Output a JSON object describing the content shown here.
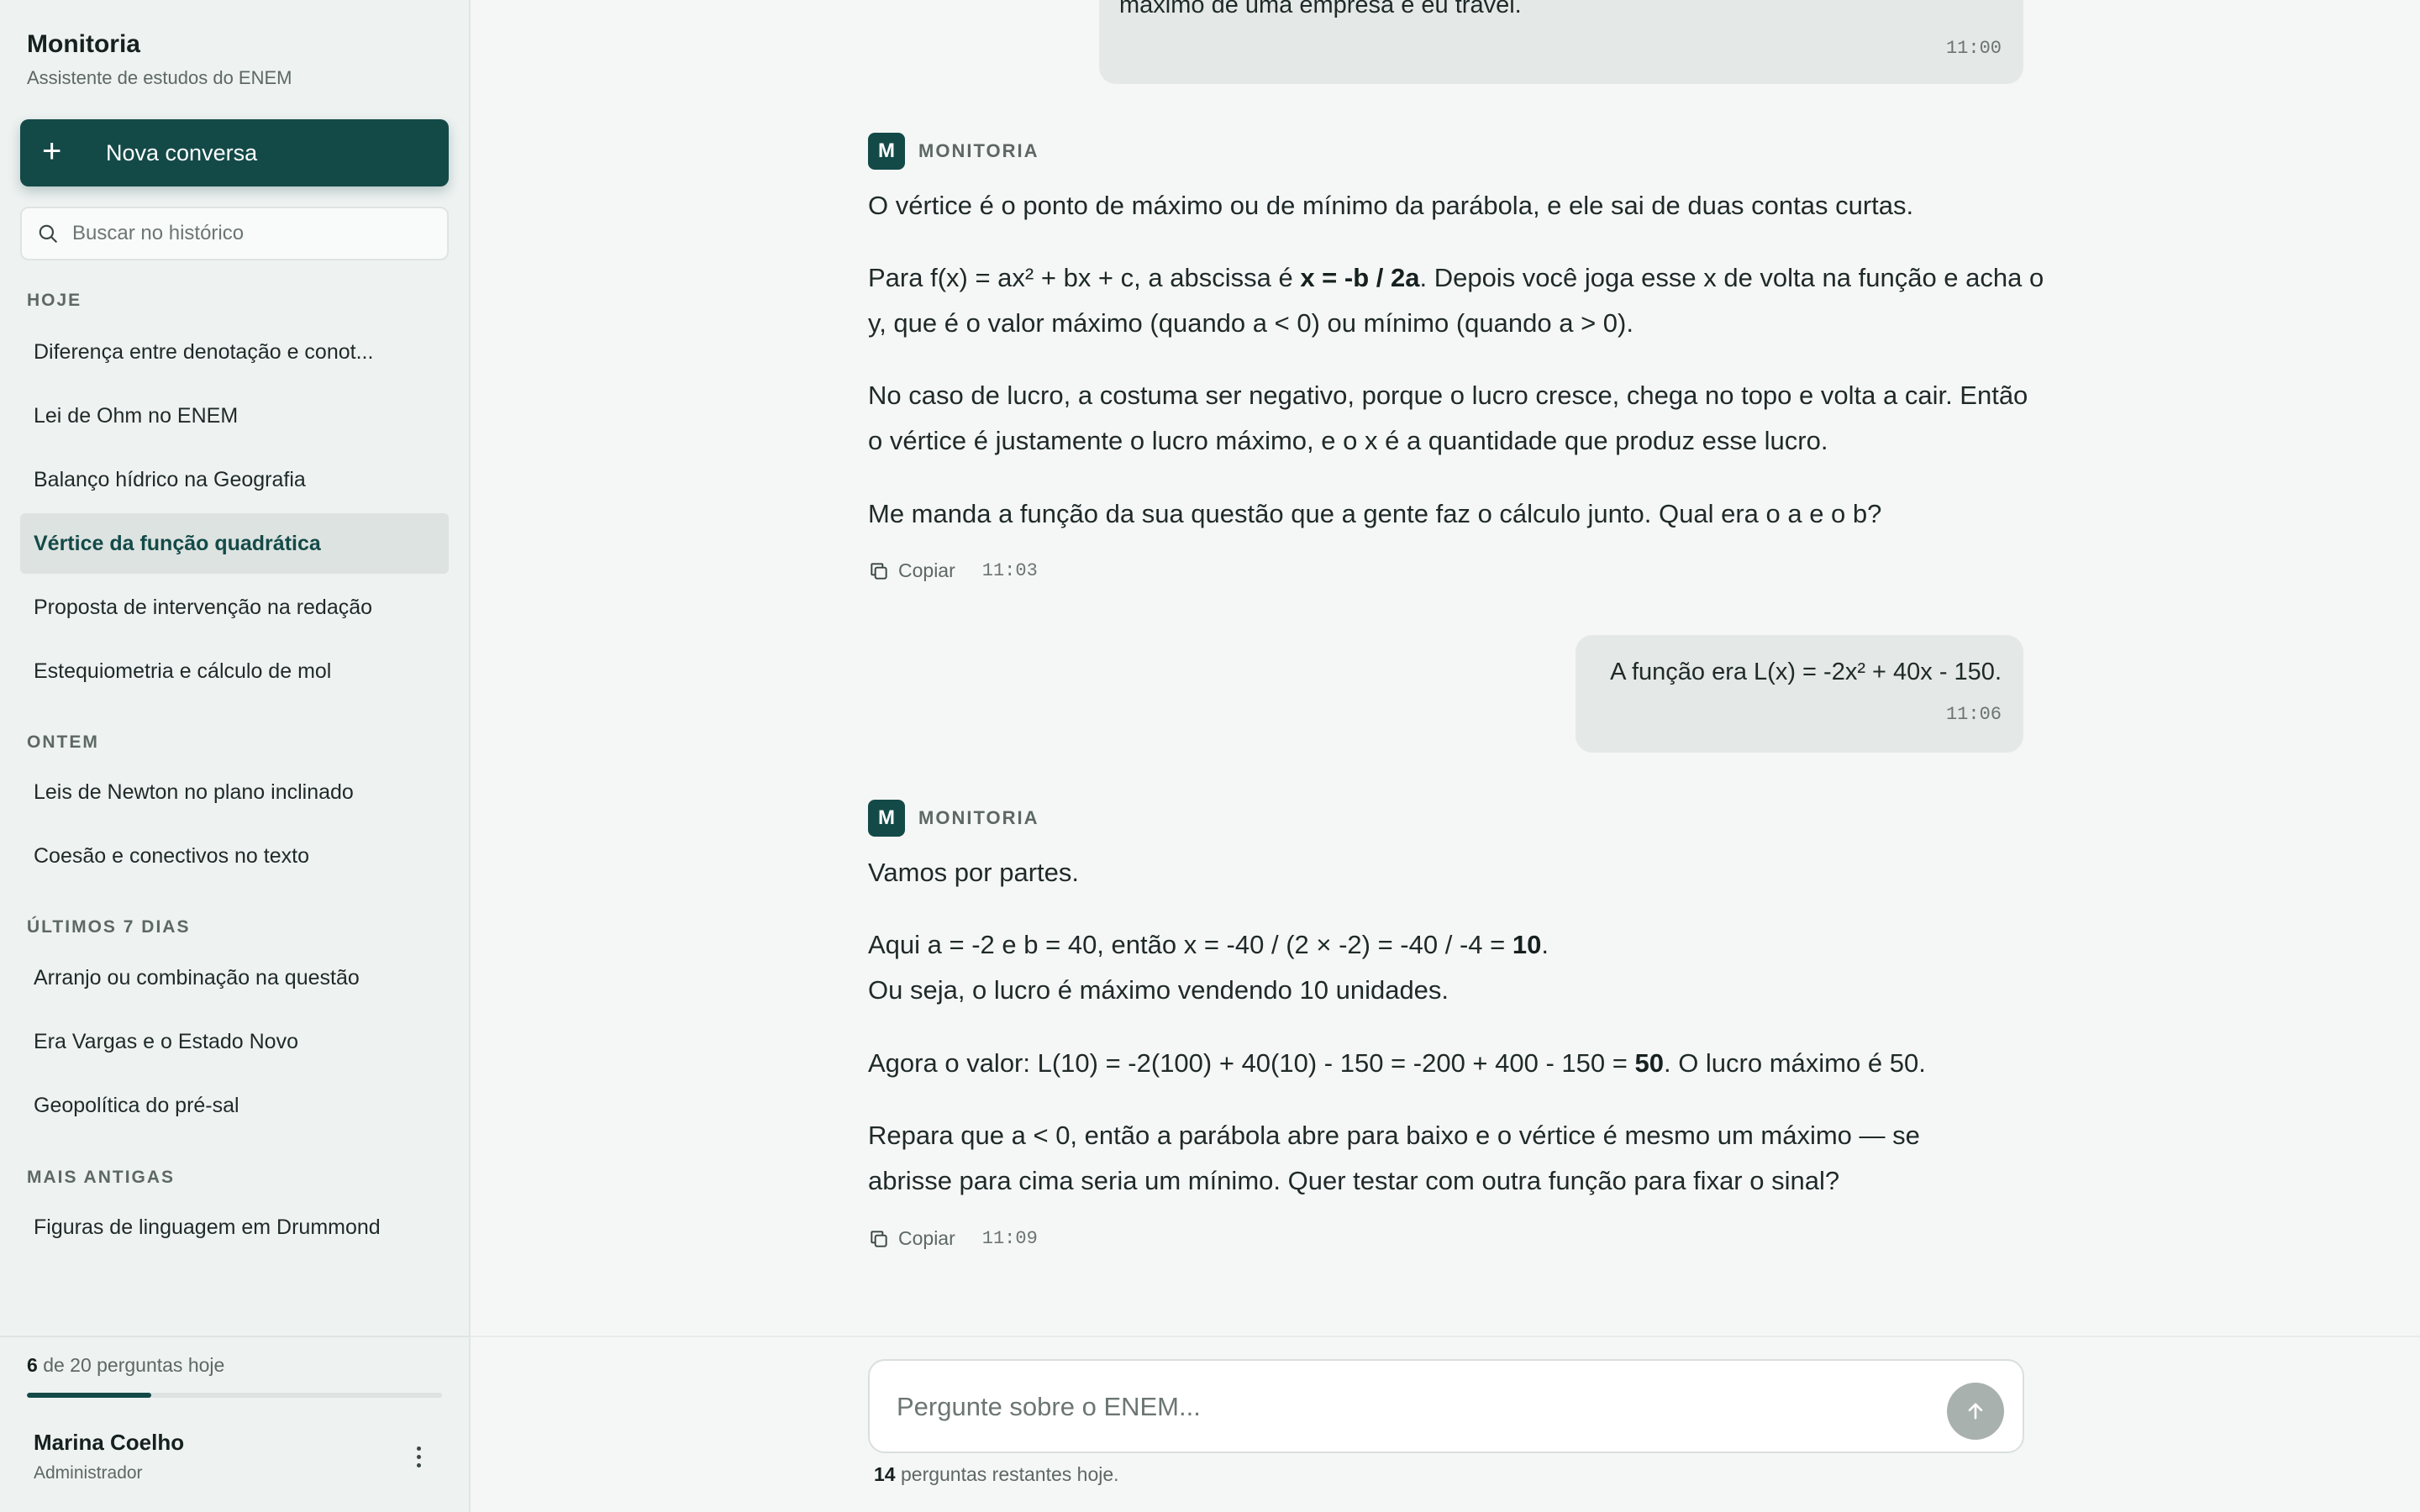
{
  "app": {
    "title": "Monitoria",
    "subtitle": "Assistente de estudos do ENEM"
  },
  "sidebar": {
    "new_chat_label": "Nova conversa",
    "search_placeholder": "Buscar no histórico",
    "sections": [
      {
        "heading": "HOJE",
        "items": [
          "Diferença entre denotação e conot...",
          "Lei de Ohm no ENEM",
          "Balanço hídrico na Geografia",
          "Vértice da função quadrática",
          "Proposta de intervenção na redação",
          "Estequiometria e cálculo de mol"
        ]
      },
      {
        "heading": "ONTEM",
        "items": [
          "Leis de Newton no plano inclinado",
          "Coesão e conectivos no texto"
        ]
      },
      {
        "heading": "ÚLTIMOS 7 DIAS",
        "items": [
          "Arranjo ou combinação na questão",
          "Era Vargas e o Estado Novo",
          "Geopolítica do pré-sal"
        ]
      },
      {
        "heading": "MAIS ANTIGAS",
        "items": [
          "Figuras de linguagem em Drummond"
        ]
      }
    ],
    "active_item": "Vértice da função quadrática",
    "quota": {
      "used": "6",
      "text": "de 20 perguntas hoje",
      "fraction": 0.3
    },
    "user": {
      "name": "Marina Coelho",
      "role": "Administrador"
    }
  },
  "chat": {
    "assistant_name": "MONITORIA",
    "assistant_avatar": "M",
    "copy_label": "Copiar",
    "messages": [
      {
        "role": "user",
        "text": "máximo de uma empresa e eu travei.",
        "time": "11:00"
      },
      {
        "role": "assistant",
        "paragraphs": [
          [
            {
              "t": "O vértice é o ponto de máximo ou de mínimo da parábola, e ele sai de duas contas curtas."
            }
          ],
          [
            {
              "t": "Para f(x) = ax² + bx + c, a abscissa é "
            },
            {
              "t": "x = -b / 2a",
              "b": true
            },
            {
              "t": ". Depois você joga esse x de volta na função e acha o y, que é o valor máximo (quando a < 0) ou mínimo (quando a > 0)."
            }
          ],
          [
            {
              "t": "No caso de lucro, a costuma ser negativo, porque o lucro cresce, chega no topo e volta a cair. Então o vértice é justamente o lucro máximo, e o x é a quantidade que produz esse lucro."
            }
          ],
          [
            {
              "t": "Me manda a função da sua questão que a gente faz o cálculo junto. Qual era o a e o b?"
            }
          ]
        ],
        "time": "11:03"
      },
      {
        "role": "user",
        "text": "A função era L(x) = -2x² + 40x - 150.",
        "time": "11:06"
      },
      {
        "role": "assistant",
        "paragraphs": [
          [
            {
              "t": "Vamos por partes."
            }
          ],
          [
            {
              "t": "Aqui a = -2 e b = 40, então x = -40 / (2 × -2) = -40 / -4 = "
            },
            {
              "t": "10",
              "b": true
            },
            {
              "t": ". Ou seja, o lucro é máximo vendendo 10 unidades."
            }
          ],
          [
            {
              "t": "Agora o valor: L(10) = -2(100) + 40(10) - 150 = -200 + 400 - 150 = "
            },
            {
              "t": "50",
              "b": true
            },
            {
              "t": ". O lucro máximo é 50."
            }
          ],
          [
            {
              "t": "Repara que a < 0, então a parábola abre para baixo e o vértice é mesmo um máximo — se abrisse para cima seria um mínimo. Quer testar com outra função para fixar o sinal?"
            }
          ]
        ],
        "time": "11:09"
      }
    ]
  },
  "composer": {
    "placeholder": "Pergunte sobre o ENEM...",
    "remaining_count": "14",
    "remaining_text": "perguntas restantes hoje."
  },
  "colors": {
    "accent": "#134a48",
    "sidebar_bg": "#eef2f1",
    "main_bg": "#f5f7f6",
    "user_bubble": "#e4e8e6",
    "active_item_bg": "#dde3e1",
    "send_disabled": "#a9b1ae"
  },
  "icons": {
    "new_chat": "plus-icon",
    "search": "search-icon",
    "copy": "copy-icon",
    "send": "arrow-up-icon",
    "menu": "kebab-icon"
  }
}
